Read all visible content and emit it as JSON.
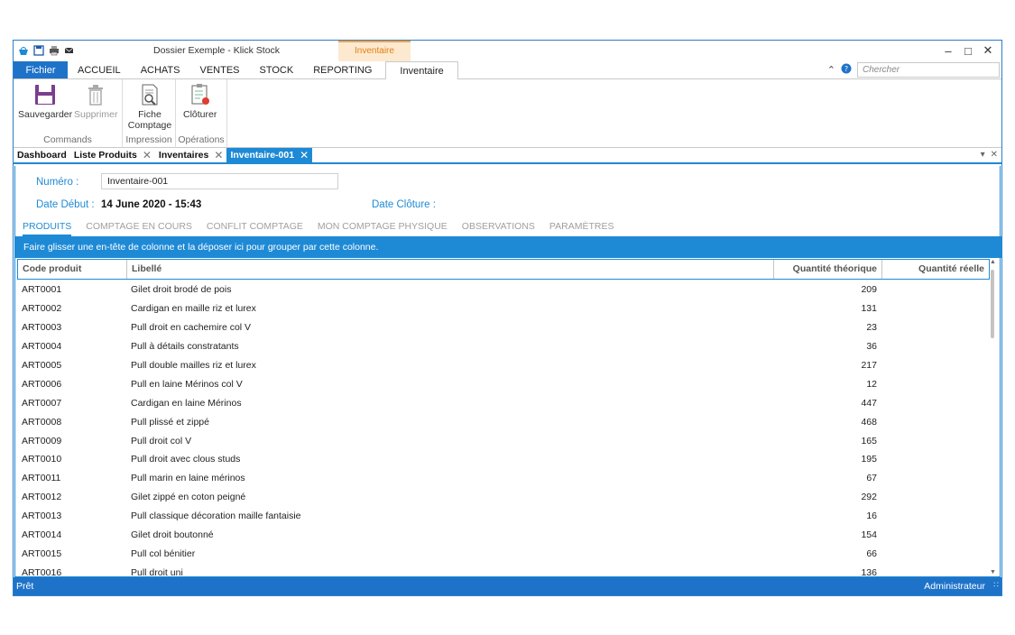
{
  "window": {
    "title": "Dossier Exemple - Klick Stock",
    "context_tab_header": "Inventaire"
  },
  "ribbon": {
    "tabs": [
      "Fichier",
      "ACCUEIL",
      "ACHATS",
      "VENTES",
      "STOCK",
      "REPORTING",
      "Inventaire"
    ],
    "search_placeholder": "Chercher",
    "groups": [
      {
        "label": "Commands",
        "buttons": [
          "Sauvegarder",
          "Supprimer"
        ]
      },
      {
        "label": "Impression",
        "buttons": [
          "Fiche\nComptage"
        ]
      },
      {
        "label": "Opérations",
        "buttons": [
          "Clôturer"
        ]
      }
    ]
  },
  "doc_tabs": [
    "Dashboard",
    "Liste Produits",
    "Inventaires",
    "Inventaire-001"
  ],
  "form": {
    "numero_label": "Numéro :",
    "numero_value": "Inventaire-001",
    "date_debut_label": "Date Début :",
    "date_debut_value": "14 June 2020 - 15:43",
    "date_cloture_label": "Date Clôture :"
  },
  "sub_tabs": [
    "PRODUITS",
    "COMPTAGE EN COURS",
    "CONFLIT COMPTAGE",
    "MON COMPTAGE PHYSIQUE",
    "OBSERVATIONS",
    "PARAMÈTRES"
  ],
  "group_panel_text": "Faire glisser une en-tête de colonne et la déposer ici pour grouper par cette colonne.",
  "grid": {
    "columns": [
      "Code produit",
      "Libellé",
      "Quantité théorique",
      "Quantité réelle"
    ],
    "rows": [
      [
        "ART0001",
        "Gilet droit brodé de pois",
        "209",
        ""
      ],
      [
        "ART0002",
        "Cardigan en maille riz et lurex",
        "131",
        ""
      ],
      [
        "ART0003",
        "Pull droit en cachemire col V",
        "23",
        ""
      ],
      [
        "ART0004",
        "Pull à détails constratants",
        "36",
        ""
      ],
      [
        "ART0005",
        "Pull double mailles riz et lurex",
        "217",
        ""
      ],
      [
        "ART0006",
        "Pull en laine Mérinos col V",
        "12",
        ""
      ],
      [
        "ART0007",
        "Cardigan en laine Mérinos",
        "447",
        ""
      ],
      [
        "ART0008",
        "Pull plissé et zippé",
        "468",
        ""
      ],
      [
        "ART0009",
        "Pull droit col V",
        "165",
        ""
      ],
      [
        "ART0010",
        "Pull droit avec clous studs",
        "195",
        ""
      ],
      [
        "ART0011",
        "Pull marin en laine mérinos",
        "67",
        ""
      ],
      [
        "ART0012",
        "Gilet zippé en coton peigné",
        "292",
        ""
      ],
      [
        "ART0013",
        "Pull classique décoration maille fantaisie",
        "16",
        ""
      ],
      [
        "ART0014",
        "Gilet droit boutonné",
        "154",
        ""
      ],
      [
        "ART0015",
        "Pull col bénitier",
        "66",
        ""
      ],
      [
        "ART0016",
        "Pull droit uni",
        "136",
        ""
      ]
    ]
  },
  "status": {
    "left": "Prêt",
    "right": "Administrateur"
  },
  "colors": {
    "accent": "#1e8ad6",
    "ribbon_file": "#1e73c9",
    "context_tab": "#f5a34d"
  },
  "icons": {
    "save": "floppy-icon",
    "delete": "trash-icon",
    "print": "print-preview-icon",
    "close": "checklist-icon"
  }
}
